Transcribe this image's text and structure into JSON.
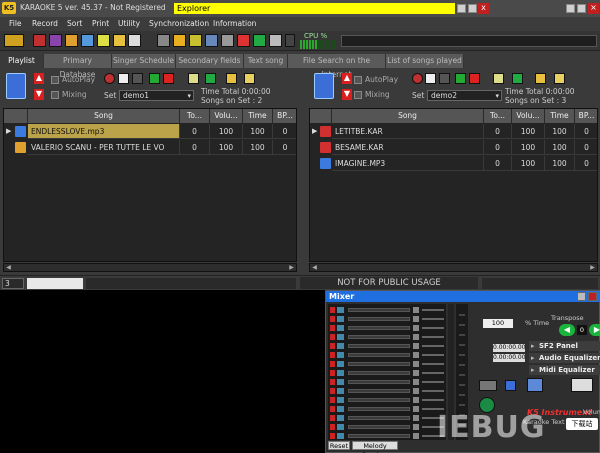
{
  "title_bar": {
    "logo": "K5",
    "app_title": "KARAOKE 5  ver. 45.37 - Not Registered",
    "explorer": "Explorer",
    "close": "x"
  },
  "menu": [
    "File",
    "Record",
    "Sort",
    "Print",
    "Utility",
    "Synchronization",
    "Information"
  ],
  "cpu": {
    "label": "CPU %"
  },
  "tabs": [
    "Playlist",
    "Primary Database",
    "Singer Schedule",
    "Secondary fields",
    "Text song",
    "File Search on the Internet",
    "List of songs played"
  ],
  "left_panel": {
    "autoplay": "AutoPlay",
    "mixing": "Mixing",
    "set_label": "Set",
    "set_value": "demo1",
    "time_total": "Time Total  0:00:00",
    "songs_on_set": "Songs on Set : 2"
  },
  "right_panel": {
    "autoplay": "AutoPlay",
    "mixing": "Mixing",
    "set_label": "Set",
    "set_value": "demo2",
    "time_total": "Time Total  0:00:00",
    "songs_on_set": "Songs on Set : 3"
  },
  "columns": [
    "Song",
    "To...",
    "Volu...",
    "Time",
    "BP..."
  ],
  "left_rows": [
    {
      "song": "ENDLESSLOVE.mp3",
      "to": "0",
      "vol": "100",
      "time": "100",
      "bp": "0",
      "selected": true
    },
    {
      "song": "VALERIO SCANU - PER TUTTE LE VO",
      "to": "0",
      "vol": "100",
      "time": "100",
      "bp": "0",
      "selected": false
    }
  ],
  "right_rows": [
    {
      "song": "LETITBE.KAR",
      "to": "0",
      "vol": "100",
      "time": "100",
      "bp": "0",
      "selected": false
    },
    {
      "song": "BESAME.KAR",
      "to": "0",
      "vol": "100",
      "time": "100",
      "bp": "0",
      "selected": false
    },
    {
      "song": "IMAGINE.MP3",
      "to": "0",
      "vol": "100",
      "time": "100",
      "bp": "0",
      "selected": false
    }
  ],
  "status": {
    "dropdown": "3",
    "notice": "NOT FOR PUBLIC USAGE"
  },
  "mixer": {
    "title": "Mixer",
    "reset": "Reset",
    "melody_preview": "Melody Preview",
    "transpose": "Transpose",
    "pct_value": "100",
    "pct_time": "% Time",
    "transpose_value": "0",
    "time1": "0.00:00.00",
    "time2": "0.00:00.00",
    "panels": [
      "SF2 Panel",
      "Audio Equalizer",
      "Midi Equalizer"
    ],
    "instrument": "K5 Instrument",
    "karaoke_text": "Karaoke Text",
    "volume": "Volume"
  },
  "watermark": {
    "text": "IEBUG",
    "tag": "下载站"
  }
}
